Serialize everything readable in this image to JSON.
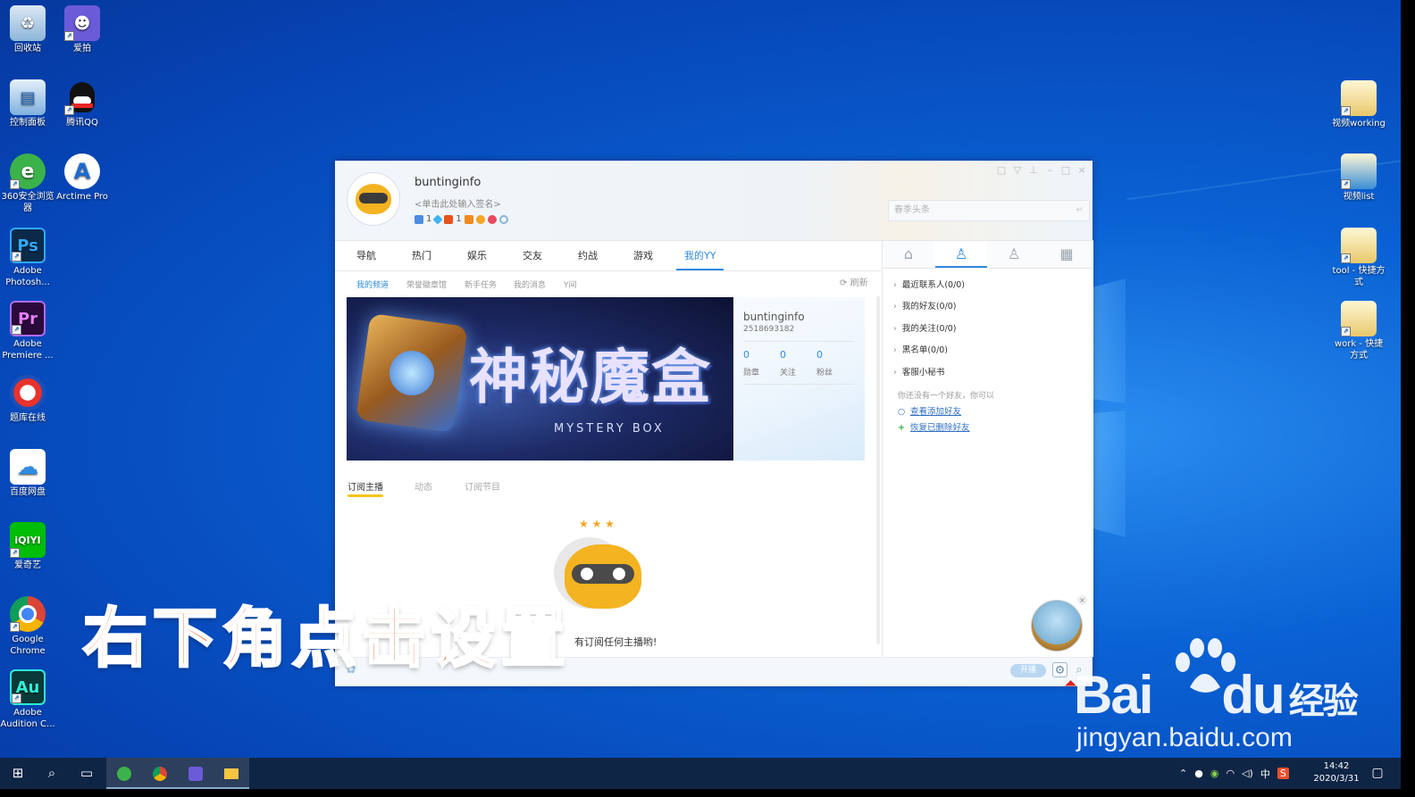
{
  "desktop": {
    "left_icons": [
      {
        "label": "回收站",
        "icon": "recycle-bin-icon",
        "color": "#6aa8d8"
      },
      {
        "label": "爱拍",
        "icon": "aipai-icon",
        "color": "#6b5bd8"
      },
      {
        "label": "控制面板",
        "icon": "control-panel-icon",
        "color": "#3a8ed6"
      },
      {
        "label": "腾讯QQ",
        "icon": "qq-icon",
        "color": "#111111"
      },
      {
        "label": "360安全浏览器",
        "icon": "360-browser-icon",
        "color": "#3cb34a"
      },
      {
        "label": "Arctime Pro",
        "icon": "arctime-icon",
        "color": "#ffffff"
      },
      {
        "label": "Adobe Photosh...",
        "icon": "photoshop-icon",
        "color": "#0b2a4a",
        "text": "Ps"
      },
      {
        "label": "Adobe Premiere ...",
        "icon": "premiere-icon",
        "color": "#2a0a3a",
        "text": "Pr"
      },
      {
        "label": "题库在线",
        "icon": "tiku-icon",
        "color": "#e8322c"
      },
      {
        "label": "百度网盘",
        "icon": "baidu-netdisk-icon",
        "color": "#2f8be0"
      },
      {
        "label": "爱奇艺",
        "icon": "iqiyi-icon",
        "color": "#00be06",
        "text": "iQIYI"
      },
      {
        "label": "Google Chrome",
        "icon": "chrome-icon",
        "color": "#ffffff"
      },
      {
        "label": "Adobe Audition C...",
        "icon": "audition-icon",
        "color": "#0a3a38",
        "text": "Au"
      }
    ],
    "right_icons": [
      {
        "label": "视频working",
        "icon": "folder-shortcut-icon"
      },
      {
        "label": "视频list",
        "icon": "folder-shortcut-icon"
      },
      {
        "label": "tool - 快捷方式",
        "icon": "folder-shortcut-icon"
      },
      {
        "label": "work - 快捷方式",
        "icon": "folder-shortcut-icon"
      }
    ]
  },
  "yy": {
    "username": "buntinginfo",
    "signature": "<单击此处输入签名>",
    "badges": [
      "1",
      "1"
    ],
    "search_placeholder": "春季头条",
    "nav_tabs": [
      "导航",
      "热门",
      "娱乐",
      "交友",
      "约战",
      "游戏",
      "我的YY"
    ],
    "active_nav": "我的YY",
    "sub_tabs": [
      "我的频道",
      "荣誉徽章馆",
      "新手任务",
      "我的消息",
      "Y间"
    ],
    "refresh_label": "刷新",
    "banner": {
      "title": "神秘魔盒",
      "subtitle": "MYSTERY BOX"
    },
    "profile": {
      "name": "buntinginfo",
      "id": "2518693182",
      "stats": [
        {
          "value": "0",
          "label": "勋章"
        },
        {
          "value": "0",
          "label": "关注"
        },
        {
          "value": "0",
          "label": "粉丝"
        }
      ]
    },
    "content_tabs": [
      "订阅主播",
      "动态",
      "订阅节目"
    ],
    "empty_message": "有订阅任何主播哟!",
    "kaibo_label": "开播",
    "right_groups": [
      "最近联系人(0/0)",
      "我的好友(0/0)",
      "我的关注(0/0)",
      "黑名单(0/0)",
      "客服小秘书"
    ],
    "no_friend_text": "你还没有一个好友，你可以",
    "links": [
      "查看添加好友",
      "恢复已删除好友"
    ]
  },
  "caption": "右下角点击设置",
  "watermark": {
    "main": "Bai",
    "du": "du",
    "jingyan": "经验",
    "sub": "jingyan.baidu.com"
  },
  "taskbar": {
    "time": "14:42",
    "date": "2020/3/31",
    "ime_label": "中",
    "apps": [
      "start-icon",
      "search-icon",
      "task-view-icon",
      "360-browser-icon",
      "chrome-icon",
      "aipai-icon",
      "file-explorer-icon"
    ]
  },
  "colors": {
    "accent": "#2f8be0",
    "caption": "#e45a2a",
    "taskbar": "#0f2546"
  }
}
